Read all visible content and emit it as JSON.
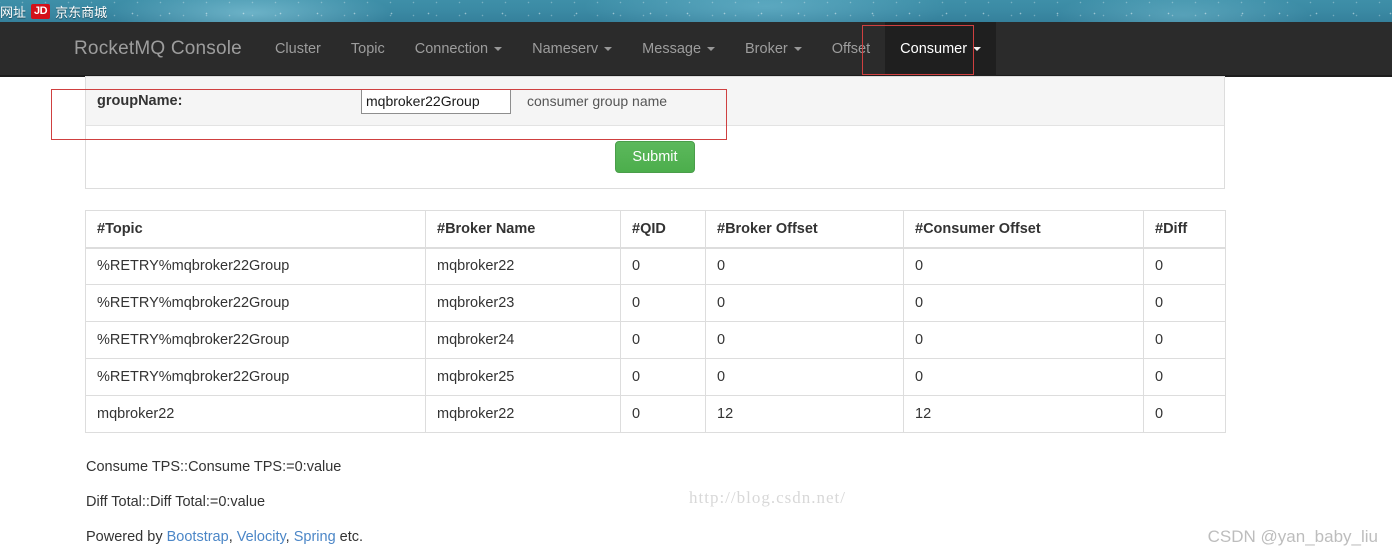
{
  "browser": {
    "bookmark_text": "网址",
    "bookmark_badge": "JD",
    "bookmark_label": "京东商城"
  },
  "navbar": {
    "brand": "RocketMQ Console",
    "items": [
      {
        "label": "Cluster",
        "has_caret": false,
        "active": false
      },
      {
        "label": "Topic",
        "has_caret": false,
        "active": false
      },
      {
        "label": "Connection",
        "has_caret": true,
        "active": false
      },
      {
        "label": "Nameserv",
        "has_caret": true,
        "active": false
      },
      {
        "label": "Message",
        "has_caret": true,
        "active": false
      },
      {
        "label": "Broker",
        "has_caret": true,
        "active": false
      },
      {
        "label": "Offset",
        "has_caret": false,
        "active": false
      },
      {
        "label": "Consumer",
        "has_caret": true,
        "active": true
      }
    ]
  },
  "form": {
    "group_name_label": "groupName:",
    "group_name_value": "mqbroker22Group",
    "group_name_placeholder": "consumer group name",
    "group_name_help": "consumer group name",
    "submit_label": "Submit"
  },
  "table": {
    "headers": [
      "#Topic",
      "#Broker Name",
      "#QID",
      "#Broker Offset",
      "#Consumer Offset",
      "#Diff"
    ],
    "rows": [
      [
        "%RETRY%mqbroker22Group",
        "mqbroker22",
        "0",
        "0",
        "0",
        "0"
      ],
      [
        "%RETRY%mqbroker22Group",
        "mqbroker23",
        "0",
        "0",
        "0",
        "0"
      ],
      [
        "%RETRY%mqbroker22Group",
        "mqbroker24",
        "0",
        "0",
        "0",
        "0"
      ],
      [
        "%RETRY%mqbroker22Group",
        "mqbroker25",
        "0",
        "0",
        "0",
        "0"
      ],
      [
        "mqbroker22",
        "mqbroker22",
        "0",
        "12",
        "12",
        "0"
      ]
    ]
  },
  "footer": {
    "consume_tps": "Consume TPS::Consume TPS:=0:value",
    "diff_total": "Diff Total::Diff Total:=0:value",
    "powered_prefix": "Powered by ",
    "link_bootstrap": "Bootstrap",
    "sep1": ", ",
    "link_velocity": "Velocity",
    "sep2": ", ",
    "link_spring": "Spring",
    "powered_suffix": " etc."
  },
  "watermarks": {
    "blog_url": "http://blog.csdn.net/",
    "csdn_author": "CSDN @yan_baby_liu"
  },
  "colors": {
    "navbar_bg": "#2b2b2b",
    "nav_active_bg": "#1f1f1f",
    "annotation_red": "#cf4040",
    "submit_green": "#5cb85c",
    "link_blue": "#4b86c7"
  }
}
